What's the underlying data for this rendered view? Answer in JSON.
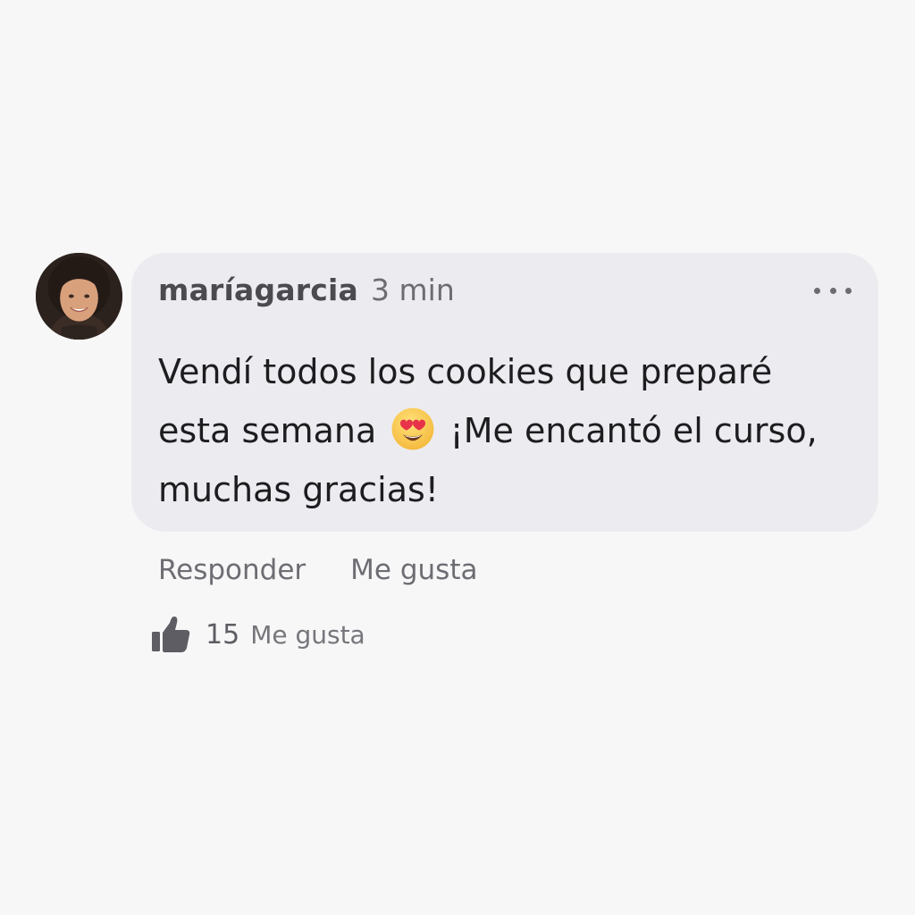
{
  "comment": {
    "username": "maríagarcia",
    "timestamp": "3 min",
    "text_part1": "Vendí todos los cookies que preparé esta semana",
    "emoji_icon": "heart-eyes-emoji-icon",
    "text_part2": "¡Me encantó el curso, muchas gracias!"
  },
  "actions": {
    "reply_label": "Responder",
    "like_label": "Me gusta"
  },
  "likes": {
    "count": "15",
    "label": "Me gusta",
    "icon": "thumbs-up-icon"
  },
  "colors": {
    "page_background": "#f7f7f7",
    "bubble_background": "#ececf0",
    "text_primary": "#1d1d1f",
    "text_secondary": "#6d6d73"
  }
}
